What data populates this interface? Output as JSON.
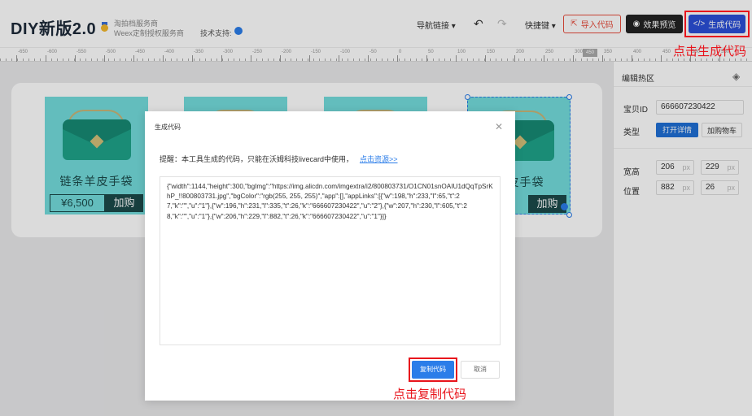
{
  "header": {
    "logo": "DIY新版2.0",
    "service_line1": "淘拍档服务商",
    "service_line2": "Weex定制授权服务商",
    "support_label": "技术支持:",
    "nav_link": "导航链接",
    "shortcut": "快捷键",
    "import_button": "导入代码",
    "preview_button": "效果预览",
    "generate_button": "生成代码"
  },
  "annotations": {
    "generate": "点击生成代码",
    "copy": "点击复制代码"
  },
  "ruler": {
    "ticks": [
      "-650",
      "-600",
      "-550",
      "-500",
      "-450",
      "-400",
      "-350",
      "-300",
      "-250",
      "-200",
      "-150",
      "-100",
      "-50",
      "0",
      "50",
      "100",
      "150",
      "200",
      "250",
      "300",
      "350",
      "400",
      "450",
      "500",
      "550"
    ],
    "marker": "450"
  },
  "canvas": {
    "cards": [
      {
        "title": "链条羊皮手袋",
        "price": "¥6,500",
        "buy": "加购"
      },
      {
        "title": "",
        "price": "",
        "buy": ""
      },
      {
        "title": "",
        "price": "",
        "buy": ""
      },
      {
        "title": "羊皮手袋",
        "price": "",
        "buy": "加购"
      }
    ]
  },
  "panel": {
    "title": "编辑热区",
    "item_id_label": "宝贝ID",
    "item_id_value": "666607230422",
    "type_label": "类型",
    "type_open": "打开详情",
    "type_cart": "加购物车",
    "size_label": "宽高",
    "width": "206",
    "height": "229",
    "pos_label": "位置",
    "x": "882",
    "y": "26",
    "unit": "px"
  },
  "dialog": {
    "title": "生成代码",
    "notice": "提醒：本工具生成的代码，只能在沃姆科技livecard中使用，",
    "notice_link": "点击资源>>",
    "code": "{\"width\":1144,\"height\":300,\"bgImg\":\"https://img.alicdn.com/imgextra/i2/800803731/O1CN01snOAIU1dQqTpSrKhP_!!800803731.jpg\",\"bgColor\":\"rgb(255, 255, 255)\",\"app\":[],\"appLinks\":[{\"w\":198,\"h\":233,\"l\":65,\"t\":27,\"k\":\"\",\"u\":\"1\"},{\"w\":196,\"h\":231,\"l\":335,\"t\":26,\"k\":\"666607230422\",\"u\":\"2\"},{\"w\":207,\"h\":230,\"l\":605,\"t\":28,\"k\":\"\",\"u\":\"1\"},{\"w\":206,\"h\":229,\"l\":882,\"t\":26,\"k\":\"666607230422\",\"u\":\"1\"}]}",
    "copy_button": "复制代码",
    "cancel_button": "取消"
  }
}
